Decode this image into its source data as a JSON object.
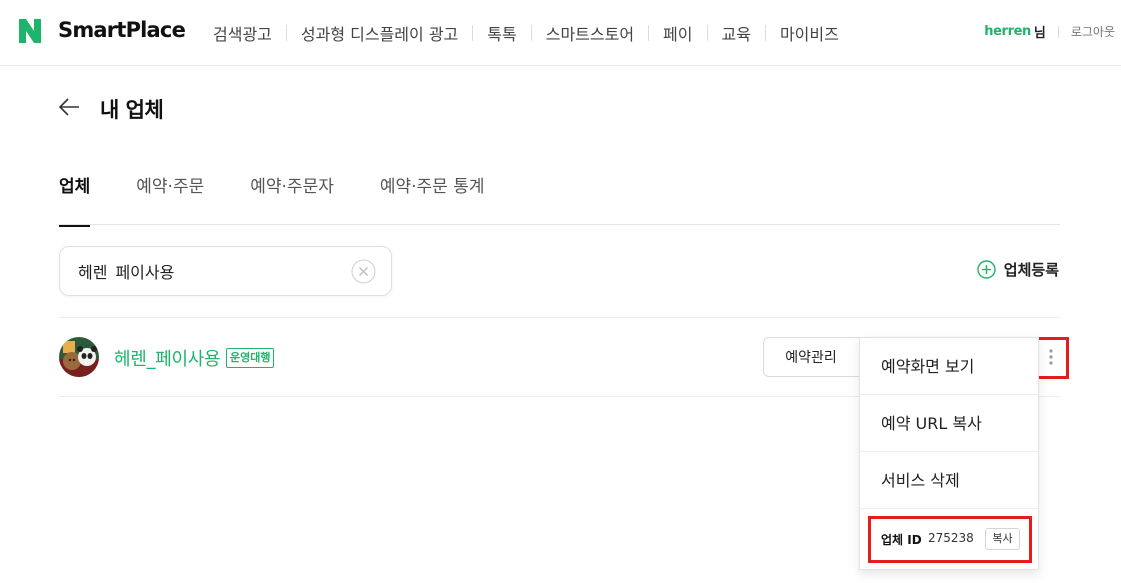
{
  "header": {
    "logo_letter": "N",
    "logo_text": "SmartPlace",
    "nav": [
      "검색광고",
      "성과형 디스플레이 광고",
      "톡톡",
      "스마트스토어",
      "페이",
      "교육",
      "마이비즈"
    ],
    "user_name": "herren",
    "user_suffix": "님",
    "logout": "로그아웃"
  },
  "page": {
    "title": "내 업체",
    "tabs": [
      "업체",
      "예약·주문",
      "예약·주문자",
      "예약·주문 통계"
    ]
  },
  "search": {
    "value": "헤렌_페이사용",
    "placeholder": ""
  },
  "register_label": "업체등록",
  "business": {
    "name": "헤렌_페이사용",
    "badge": "운영대행",
    "manage_label": "예약관리"
  },
  "dropdown": {
    "items": [
      "예약화면 보기",
      "예약 URL 복사",
      "서비스 삭제"
    ],
    "id_label": "업체 ID",
    "id_value": "275238",
    "copy_label": "복사"
  },
  "colors": {
    "brand_green": "#1db56b",
    "highlight_red": "#e31c1c"
  },
  "icons": [
    "back-arrow-icon",
    "clear-icon",
    "plus-circle-icon",
    "more-vertical-icon"
  ]
}
